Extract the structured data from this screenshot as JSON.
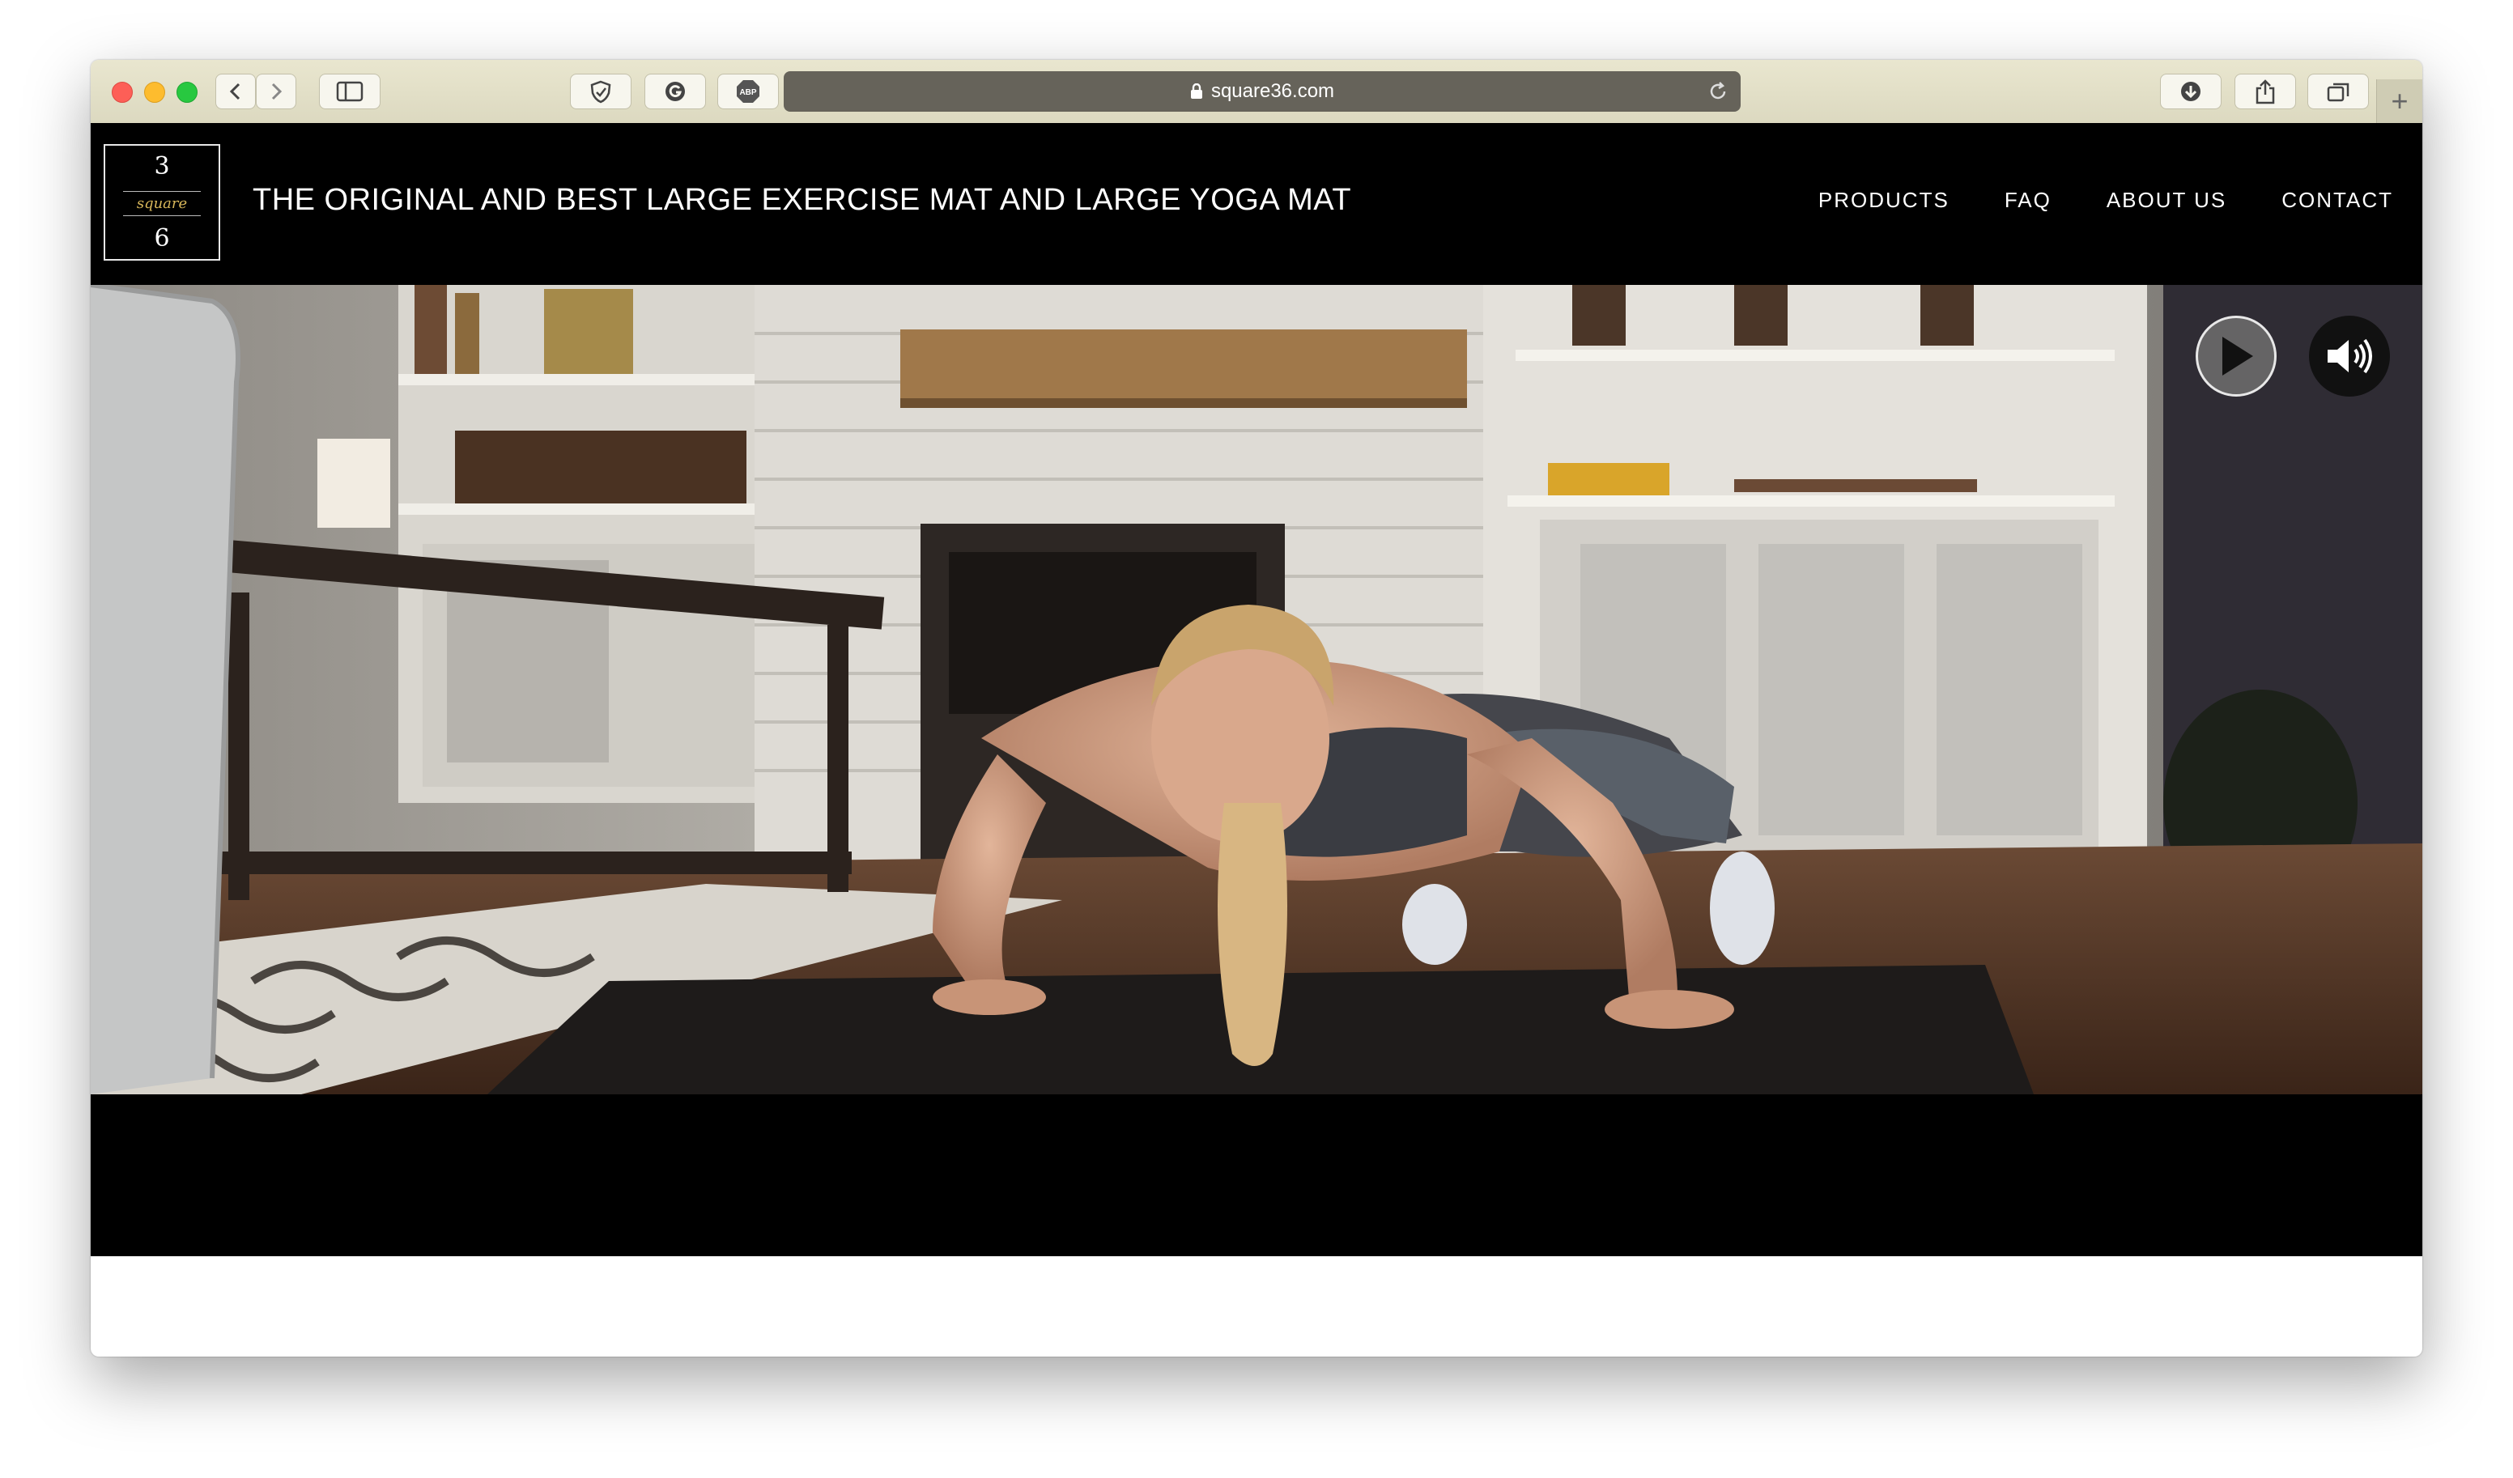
{
  "browser": {
    "url": "square36.com",
    "toolbar_buttons": [
      "back-icon",
      "forward-icon",
      "sidebar-icon",
      "privacy-shield-icon",
      "grammarly-icon",
      "adblock-abp-icon",
      "downloads-icon",
      "share-icon",
      "tabs-icon",
      "new-tab-icon"
    ],
    "new_tab_glyph": "+"
  },
  "site": {
    "logo": {
      "top": "3",
      "middle": "square",
      "bottom": "6"
    },
    "title": "THE ORIGINAL AND BEST LARGE EXERCISE MAT AND LARGE YOGA MAT",
    "nav": [
      "PRODUCTS",
      "FAQ",
      "ABOUT US",
      "CONTACT"
    ]
  },
  "hero": {
    "description_icons": [
      "play-icon",
      "volume-icon"
    ]
  },
  "colors": {
    "header_bg": "#000000",
    "toolbar_bg": "#e4e1c8",
    "url_bar_bg": "#66635a",
    "logo_accent": "#d8b75a"
  }
}
